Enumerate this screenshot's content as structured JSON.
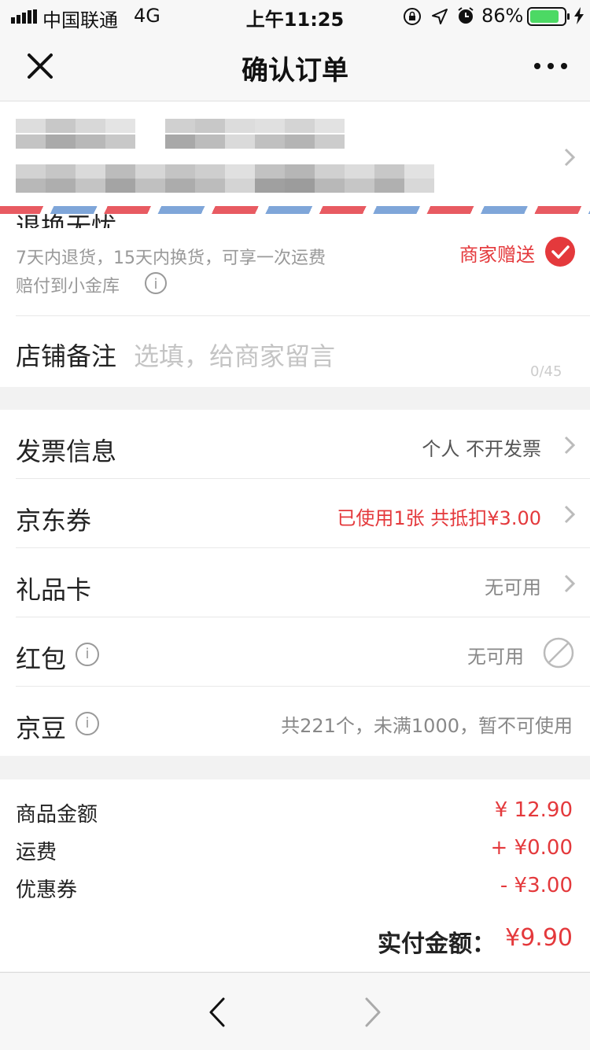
{
  "status_bar": {
    "carrier": "中国联通",
    "network": "4G",
    "time": "上午11:25",
    "battery_percent": "86%",
    "battery_level": 0.86
  },
  "nav": {
    "title": "确认订单",
    "close_icon": "close-icon",
    "more_icon": "more-icon"
  },
  "return_policy": {
    "title": "退换无忧",
    "desc_line1": "7天内退货，15天内换货，可享一次运费",
    "desc_line2": "赔付到小金库",
    "badge": "商家赠送"
  },
  "shop_note": {
    "label": "店铺备注",
    "placeholder": "选填，给商家留言",
    "counter": "0/45"
  },
  "rows": {
    "invoice": {
      "label": "发票信息",
      "value": "个人 不开发票"
    },
    "coupon": {
      "label": "京东券",
      "value": "已使用1张 共抵扣¥3.00"
    },
    "giftcard": {
      "label": "礼品卡",
      "value": "无可用"
    },
    "redpacket": {
      "label": "红包",
      "value": "无可用"
    },
    "jingdou": {
      "label": "京豆",
      "value": "共221个，未满1000，暂不可使用"
    }
  },
  "summary": {
    "goods_label": "商品金额",
    "goods_value": "¥ 12.90",
    "shipping_label": "运费",
    "shipping_value": "+ ¥0.00",
    "discount_label": "优惠券",
    "discount_value": "- ¥3.00",
    "total_label": "实付金额：",
    "total_value": "¥9.90"
  },
  "colors": {
    "accent_red": "#e4393c",
    "stripe_red": "#e85b62",
    "stripe_blue": "#7fa6d9"
  }
}
